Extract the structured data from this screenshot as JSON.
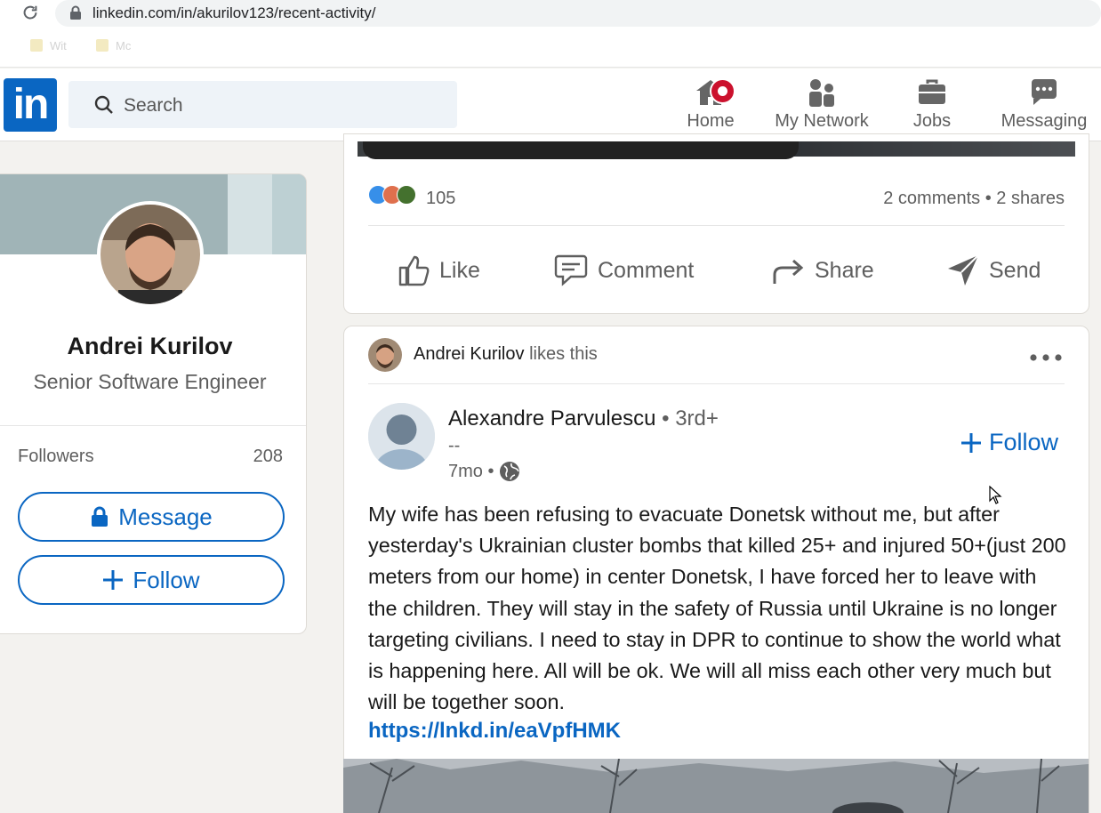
{
  "browser": {
    "url": "linkedin.com/in/akurilov123/recent-activity/",
    "bookmarks": [
      "Wit",
      "Mc"
    ]
  },
  "header": {
    "logo": "in",
    "search_placeholder": "Search",
    "nav": [
      {
        "label": "Home",
        "icon": "home-icon",
        "has_badge": true
      },
      {
        "label": "My Network",
        "icon": "people-icon"
      },
      {
        "label": "Jobs",
        "icon": "briefcase-icon"
      },
      {
        "label": "Messaging",
        "icon": "chat-bubble-icon"
      }
    ]
  },
  "profile": {
    "name": "Andrei Kurilov",
    "headline": "Senior Software Engineer",
    "followers_label": "Followers",
    "followers_count": "208",
    "message_label": "Message",
    "follow_label": "Follow"
  },
  "previous_post": {
    "reaction_count": "105",
    "comments_shares": "2 comments • 2 shares",
    "actions": [
      "Like",
      "Comment",
      "Share",
      "Send"
    ]
  },
  "post": {
    "liker_name": "Andrei Kurilov",
    "liker_suffix": "likes this",
    "author_name": "Alexandre Parvulescu",
    "author_degree": "• 3rd+",
    "author_subtitle": "--",
    "time": "7mo •",
    "follow_label": "Follow",
    "body": "My wife has been refusing to evacuate Donetsk without me, but after yesterday's Ukrainian cluster bombs that killed 25+ and injured 50+(just 200 meters from our home) in center Donetsk, I have forced her to leave with the children. They will stay in the safety of Russia until Ukraine is no longer targeting civilians. I need to stay in DPR to continue to show the world what is happening here. All will be ok. We will all miss each other very much but will be together soon.",
    "link": "https://lnkd.in/eaVpfHMK"
  },
  "colors": {
    "brand": "#0a66c2",
    "badge": "#cb112d",
    "page_bg": "#f3f2ef"
  }
}
